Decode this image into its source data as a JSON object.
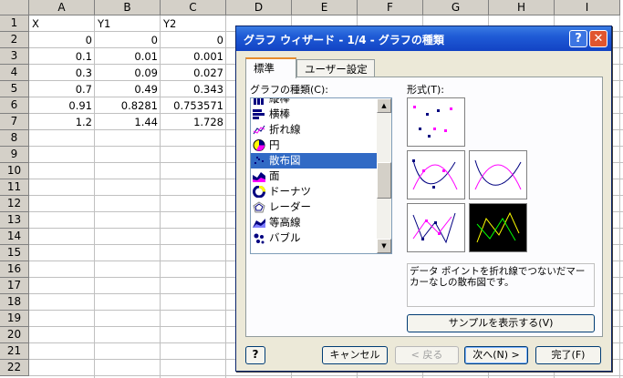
{
  "sheet": {
    "columns": [
      "A",
      "B",
      "C",
      "D",
      "E",
      "F",
      "G",
      "H",
      "I"
    ],
    "rows": [
      "1",
      "2",
      "3",
      "4",
      "5",
      "6",
      "7",
      "8",
      "9",
      "10",
      "11",
      "12",
      "13",
      "14",
      "15",
      "16",
      "17",
      "18",
      "19",
      "20",
      "21",
      "22"
    ],
    "cells": [
      [
        "X",
        "Y1",
        "Y2"
      ],
      [
        "0",
        "0",
        "0"
      ],
      [
        "0.1",
        "0.01",
        "0.001"
      ],
      [
        "0.3",
        "0.09",
        "0.027"
      ],
      [
        "0.7",
        "0.49",
        "0.343"
      ],
      [
        "0.91",
        "0.8281",
        "0.753571"
      ],
      [
        "1.2",
        "1.44",
        "1.728"
      ]
    ]
  },
  "dialog": {
    "title": "グラフ ウィザード - 1/4 - グラフの種類",
    "help_glyph": "?",
    "close_glyph": "✕",
    "tabs": [
      {
        "label": "標準"
      },
      {
        "label": "ユーザー設定"
      }
    ],
    "type_label": "グラフの種類(C):",
    "form_label": "形式(T):",
    "chart_types": [
      {
        "label": "縦棒",
        "icon": "column-chart-icon"
      },
      {
        "label": "横棒",
        "icon": "bar-chart-icon"
      },
      {
        "label": "折れ線",
        "icon": "line-chart-icon"
      },
      {
        "label": "円",
        "icon": "pie-chart-icon"
      },
      {
        "label": "散布図",
        "icon": "scatter-chart-icon"
      },
      {
        "label": "面",
        "icon": "area-chart-icon"
      },
      {
        "label": "ドーナツ",
        "icon": "doughnut-chart-icon"
      },
      {
        "label": "レーダー",
        "icon": "radar-chart-icon"
      },
      {
        "label": "等高線",
        "icon": "surface-chart-icon"
      },
      {
        "label": "バブル",
        "icon": "bubble-chart-icon"
      }
    ],
    "selected_type": "散布図",
    "description": "データ ポイントを折れ線でつないだマーカーなしの散布図です。",
    "sample_button": "サンプルを表示する(V)",
    "bottom_help_glyph": "?",
    "buttons": {
      "cancel": "キャンセル",
      "back": "< 戻る",
      "next": "次へ(N) >",
      "finish": "完了(F)"
    },
    "colors": {
      "title_bar": "#1f5bd6",
      "selection": "#316ac5",
      "close": "#e0552f"
    }
  }
}
